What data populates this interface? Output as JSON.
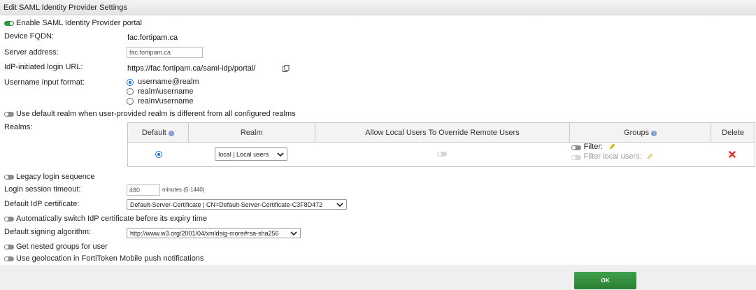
{
  "window": {
    "title": "Edit SAML Identity Provider Settings"
  },
  "enable_portal": {
    "label": "Enable SAML Identity Provider portal",
    "on": true
  },
  "device_fqdn": {
    "label": "Device FQDN:",
    "value": "fac.fortipam.ca"
  },
  "server_address": {
    "label": "Server address:",
    "value": "fac.fortipam.ca"
  },
  "idp_login_url": {
    "label": "IdP-initiated login URL:",
    "value": "https://fac.fortipam.ca/saml-idp/portal/",
    "copy_icon": "copy-icon"
  },
  "username_format": {
    "label": "Username input format:",
    "options": [
      "username@realm",
      "realm\\username",
      "realm/username"
    ],
    "selected": "username@realm"
  },
  "default_realm_toggle": {
    "label": "Use default realm when user-provided realm is different from all configured realms",
    "on": false
  },
  "realms": {
    "label": "Realms:",
    "columns": {
      "default": "Default",
      "realm": "Realm",
      "allow_override": "Allow Local Users To Override Remote Users",
      "groups": "Groups",
      "delete": "Delete"
    },
    "rows": [
      {
        "default": true,
        "realm": "local | Local users",
        "allow_override": false,
        "filter_label": "Filter:",
        "filter_local_label": "Filter local users:"
      }
    ]
  },
  "legacy_login": {
    "label": "Legacy login sequence",
    "on": false
  },
  "session_timeout": {
    "label": "Login session timeout:",
    "value": "480",
    "hint": "minutes (5-1440)"
  },
  "idp_certificate": {
    "label": "Default IdP certificate:",
    "value": "Default-Server-Certificate | CN=Default-Server-Certificate-C3F8D472"
  },
  "auto_switch_cert": {
    "label": "Automatically switch IdP certificate before its expiry time",
    "on": false
  },
  "signing_algorithm": {
    "label": "Default signing algorithm:",
    "value": "http://www.w3.org/2001/04/xmldsig-more#rsa-sha256"
  },
  "nested_groups": {
    "label": "Get nested groups for user",
    "on": false
  },
  "geolocation": {
    "label": "Use geolocation in FortiToken Mobile push notifications",
    "on": false
  },
  "footer": {
    "ok_label": "OK"
  },
  "colors": {
    "toggle_on": "#2e9a3c",
    "toggle_off": "#8b8b8b",
    "ok_button": "#2b7f33",
    "delete_icon": "#d9342b",
    "pencil": "#e0b800"
  }
}
